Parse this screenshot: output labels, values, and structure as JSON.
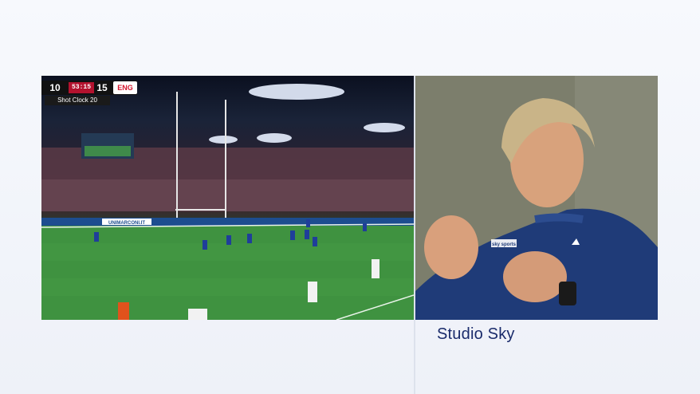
{
  "scoreboard": {
    "home_score": "10",
    "clock": "53:15",
    "away_score": "15",
    "away_team": "ENG",
    "shot_clock": "Shot Clock  20"
  },
  "pitch_ad": "UNIMARCONI.IT",
  "presenter_shirt_logo": "sky sports",
  "caption": "Studio Sky"
}
